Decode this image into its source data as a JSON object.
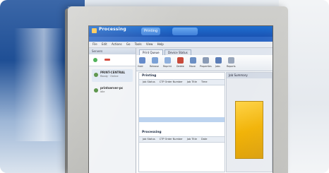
{
  "titlebar": {
    "title": "Processing",
    "tab1": "Printing",
    "tab2": ""
  },
  "menubar": {
    "items": [
      "File",
      "Edit",
      "Actions",
      "Go",
      "Tools",
      "View",
      "Help"
    ]
  },
  "left_panel": {
    "header": "Servers",
    "server1": "PRINT-CENTRAL",
    "server1_sub": "Ready · Online",
    "server2": "printserver-pc",
    "server2_sub": "Idle"
  },
  "main_tabs": {
    "tab1": "Print Queue",
    "tab2": "Device Status"
  },
  "ribbon": {
    "labels": [
      "Hold",
      "Release",
      "Reprint",
      "Delete",
      "Move",
      "Properties",
      "Jobs",
      "Reports"
    ]
  },
  "printing_panel": {
    "title": "Printing",
    "col1": "Job Status",
    "col2": "CTP Order Number",
    "col3": "Job Title",
    "col4": "Time"
  },
  "processing_panel": {
    "title": "Processing",
    "col1": "Job Status",
    "col2": "CTP Order Number",
    "col3": "Job Title",
    "col4": "Date"
  },
  "right_panel": {
    "title": "Job Summary"
  },
  "colors": {
    "titlebar": "#1a53b3",
    "accent_tab": "#3f7fd8",
    "document": "#f1b100",
    "wall_blue": "#1f4f95"
  }
}
